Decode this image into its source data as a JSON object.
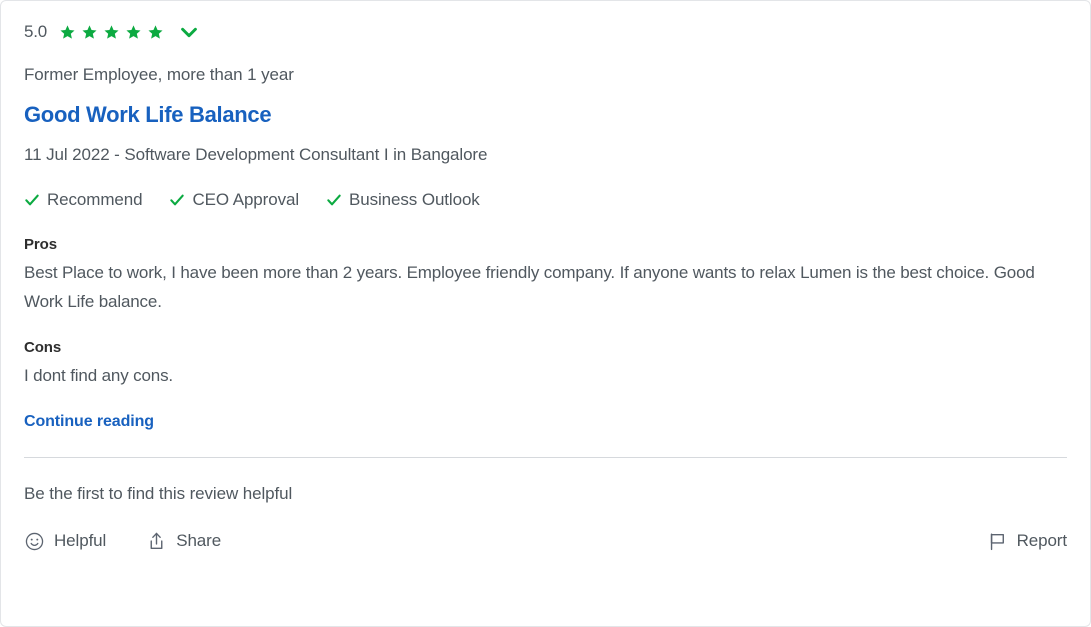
{
  "review": {
    "rating": "5.0",
    "star_count": 5,
    "star_icon": "star-icon",
    "expand_icon": "chevron-down-icon",
    "employee_meta": "Former Employee, more than 1 year",
    "title": "Good Work Life Balance",
    "subline": "11 Jul 2022 - Software Development Consultant I in Bangalore",
    "attributes": [
      {
        "label": "Recommend",
        "icon": "check-icon"
      },
      {
        "label": "CEO Approval",
        "icon": "check-icon"
      },
      {
        "label": "Business Outlook",
        "icon": "check-icon"
      }
    ],
    "pros": {
      "heading": "Pros",
      "text": "Best Place to work, I have been more than 2 years. Employee friendly company. If anyone wants to relax Lumen is the best choice. Good Work Life balance."
    },
    "cons": {
      "heading": "Cons",
      "text": "I dont find any cons."
    },
    "continue_reading": "Continue reading",
    "helpful_note": "Be the first to find this review helpful",
    "actions": {
      "helpful": {
        "label": "Helpful",
        "icon": "smiley-face-icon"
      },
      "share": {
        "label": "Share",
        "icon": "share-icon"
      },
      "report": {
        "label": "Report",
        "icon": "flag-icon"
      }
    }
  },
  "colors": {
    "star_green": "#0caa41",
    "link_blue": "#1861bf",
    "body_text": "#50585f",
    "heading_text": "#2e2e2e",
    "border": "#e3e5e8",
    "divider": "#d6d9dd"
  }
}
